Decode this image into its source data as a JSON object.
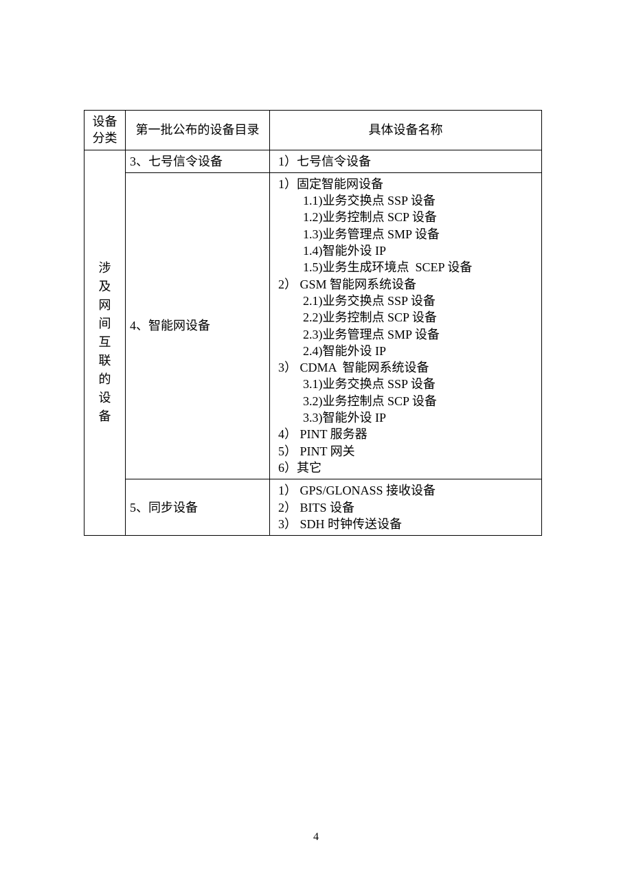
{
  "headers": {
    "col1_line1": "设备",
    "col1_line2": "分类",
    "col2": "第一批公布的设备目录",
    "col3": "具体设备名称"
  },
  "category_label": "涉及网间互联的设备",
  "rows": [
    {
      "dir": "3、七号信令设备",
      "details": [
        {
          "lvl": 1,
          "text": "1）七号信令设备"
        }
      ]
    },
    {
      "dir": "4、智能网设备",
      "details": [
        {
          "lvl": 1,
          "text": "1）固定智能网设备"
        },
        {
          "lvl": 2,
          "text": "1.1)业务交换点 SSP 设备"
        },
        {
          "lvl": 2,
          "text": "1.2)业务控制点 SCP 设备"
        },
        {
          "lvl": 2,
          "text": "1.3)业务管理点 SMP 设备"
        },
        {
          "lvl": 2,
          "text": "1.4)智能外设 IP"
        },
        {
          "lvl": 2,
          "text": "1.5)业务生成环境点  SCEP 设备"
        },
        {
          "lvl": 1,
          "text": "2） GSM 智能网系统设备"
        },
        {
          "lvl": 2,
          "text": "2.1)业务交换点 SSP 设备"
        },
        {
          "lvl": 2,
          "text": "2.2)业务控制点 SCP 设备"
        },
        {
          "lvl": 2,
          "text": "2.3)业务管理点 SMP 设备"
        },
        {
          "lvl": 2,
          "text": "2.4)智能外设 IP"
        },
        {
          "lvl": 1,
          "text": "3） CDMA  智能网系统设备"
        },
        {
          "lvl": 2,
          "text": "3.1)业务交换点 SSP 设备"
        },
        {
          "lvl": 2,
          "text": "3.2)业务控制点 SCP 设备"
        },
        {
          "lvl": 2,
          "text": "3.3)智能外设 IP"
        },
        {
          "lvl": 1,
          "text": "4） PINT 服务器"
        },
        {
          "lvl": 1,
          "text": "5） PINT 网关"
        },
        {
          "lvl": 1,
          "text": "6）其它"
        }
      ]
    },
    {
      "dir": "5、同步设备",
      "details": [
        {
          "lvl": 1,
          "text": "1） GPS/GLONASS 接收设备"
        },
        {
          "lvl": 1,
          "text": "2） BITS 设备"
        },
        {
          "lvl": 1,
          "text": "3） SDH 时钟传送设备"
        }
      ]
    }
  ],
  "page_number": "4"
}
